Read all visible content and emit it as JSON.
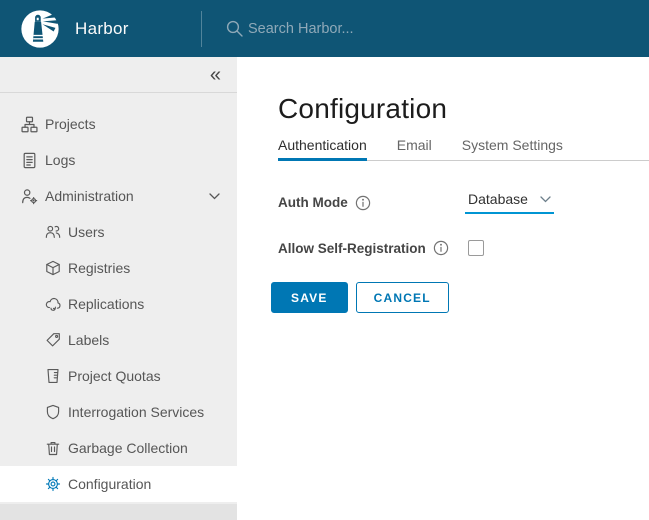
{
  "header": {
    "app_title": "Harbor",
    "search_placeholder": "Search Harbor..."
  },
  "sidebar": {
    "collapse_glyph": "«",
    "items": [
      {
        "label": "Projects",
        "level": 1
      },
      {
        "label": "Logs",
        "level": 1
      },
      {
        "label": "Administration",
        "level": 1,
        "expanded": true
      },
      {
        "label": "Users",
        "level": 2
      },
      {
        "label": "Registries",
        "level": 2
      },
      {
        "label": "Replications",
        "level": 2
      },
      {
        "label": "Labels",
        "level": 2
      },
      {
        "label": "Project Quotas",
        "level": 2
      },
      {
        "label": "Interrogation Services",
        "level": 2
      },
      {
        "label": "Garbage Collection",
        "level": 2
      },
      {
        "label": "Configuration",
        "level": 2,
        "selected": true
      }
    ]
  },
  "main": {
    "page_title": "Configuration",
    "tabs": [
      {
        "label": "Authentication",
        "active": true
      },
      {
        "label": "Email",
        "active": false
      },
      {
        "label": "System Settings",
        "active": false
      }
    ],
    "form": {
      "auth_mode": {
        "label": "Auth Mode",
        "value": "Database"
      },
      "self_registration": {
        "label": "Allow Self-Registration",
        "checked": false
      },
      "buttons": {
        "save": "SAVE",
        "cancel": "CANCEL"
      }
    }
  },
  "colors": {
    "header_bg": "#0f5575",
    "primary": "#0077b4",
    "underline": "#0095d3",
    "gear_blue": "#0079b8",
    "sidebar_bg": "#eeeeee",
    "selected_bg": "#ffffff"
  }
}
